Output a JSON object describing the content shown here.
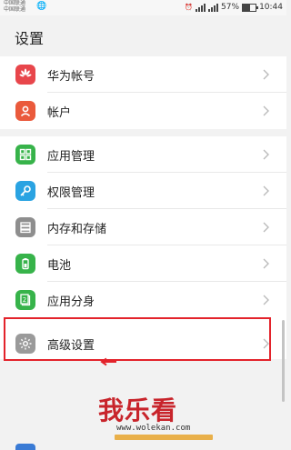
{
  "status_bar": {
    "carrier1": "中国联通",
    "carrier2": "中国联通",
    "battery_text": "57%",
    "time": "10:44"
  },
  "header": {
    "title": "设置"
  },
  "groups": [
    {
      "items": [
        {
          "label": "华为帐号",
          "icon": "huawei-logo-icon",
          "color": "#e8464b"
        },
        {
          "label": "帐户",
          "icon": "account-person-icon",
          "color": "#ea5a3c"
        }
      ]
    },
    {
      "items": [
        {
          "label": "应用管理",
          "icon": "apps-grid-icon",
          "color": "#37b34a"
        },
        {
          "label": "权限管理",
          "icon": "key-icon",
          "color": "#2aa3e2"
        },
        {
          "label": "内存和存储",
          "icon": "storage-icon",
          "color": "#8e8e8e"
        },
        {
          "label": "电池",
          "icon": "battery-icon",
          "color": "#37b34a"
        },
        {
          "label": "应用分身",
          "icon": "app-twin-icon",
          "color": "#37b34a"
        },
        {
          "label": "高级设置",
          "icon": "gear-icon",
          "color": "#9a9a9a"
        }
      ]
    }
  ],
  "watermark": {
    "text": "我乐看",
    "url": "www.wolekan.com"
  },
  "colors": {
    "highlight": "#e3232b",
    "background": "#f2f2f2"
  }
}
